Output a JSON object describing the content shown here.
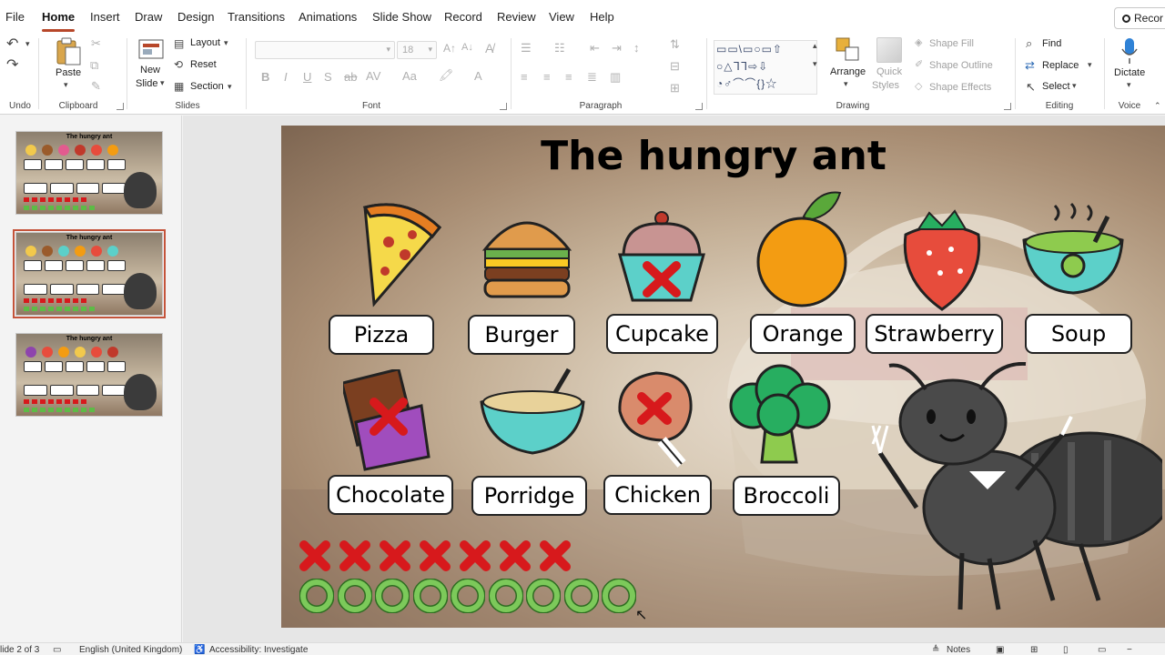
{
  "menu": {
    "tabs": [
      "File",
      "Home",
      "Insert",
      "Draw",
      "Design",
      "Transitions",
      "Animations",
      "Slide Show",
      "Record",
      "Review",
      "View",
      "Help"
    ],
    "active_tab": "Home",
    "record_button": "Recor"
  },
  "ribbon": {
    "undo": {
      "label": "Undo"
    },
    "clipboard": {
      "label": "Clipboard",
      "paste": "Paste"
    },
    "slides": {
      "label": "Slides",
      "new_slide_line1": "New",
      "new_slide_line2": "Slide",
      "layout": "Layout",
      "reset": "Reset",
      "section": "Section"
    },
    "font": {
      "label": "Font",
      "font_size": "18"
    },
    "paragraph": {
      "label": "Paragraph"
    },
    "drawing": {
      "label": "Drawing",
      "arrange": "Arrange",
      "quick_styles_line1": "Quick",
      "quick_styles_line2": "Styles",
      "shape_fill": "Shape Fill",
      "shape_outline": "Shape Outline",
      "shape_effects": "Shape Effects"
    },
    "editing": {
      "label": "Editing",
      "find": "Find",
      "replace": "Replace",
      "select": "Select"
    },
    "voice": {
      "label": "Voice",
      "dictate": "Dictate"
    }
  },
  "thumbnails": [
    {
      "number": "1",
      "title": "The hungry ant"
    },
    {
      "number": "2",
      "title": "The hungry ant"
    },
    {
      "number": "3",
      "title": "The hungry ant"
    }
  ],
  "slide": {
    "title": "The hungry ant",
    "foods": [
      {
        "name": "Pizza",
        "crossed": false
      },
      {
        "name": "Burger",
        "crossed": false
      },
      {
        "name": "Cupcake",
        "crossed": true
      },
      {
        "name": "Orange",
        "crossed": false
      },
      {
        "name": "Strawberry",
        "crossed": false
      },
      {
        "name": "Soup",
        "crossed": false
      },
      {
        "name": "Chocolate",
        "crossed": true
      },
      {
        "name": "Porridge",
        "crossed": false
      },
      {
        "name": "Chicken",
        "crossed": true
      },
      {
        "name": "Broccoli",
        "crossed": false
      }
    ],
    "wrong_count": 7,
    "right_count": 9
  },
  "statusbar": {
    "slide_info": "lide 2 of 3",
    "language": "English (United Kingdom)",
    "accessibility": "Accessibility: Investigate",
    "notes": "Notes"
  },
  "colors": {
    "accent": "#b7472a",
    "cross": "#d7191c",
    "ring": "#7cc95a"
  }
}
